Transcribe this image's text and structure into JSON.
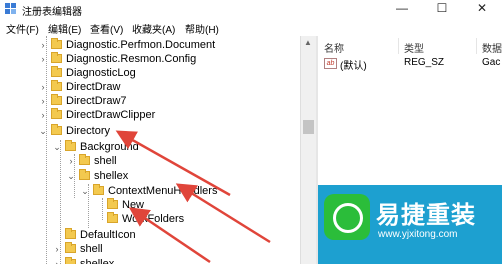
{
  "window": {
    "title": "注册表编辑器",
    "minimize": "—",
    "maximize": "☐",
    "close": "✕"
  },
  "menu": [
    "文件(F)",
    "编辑(E)",
    "查看(V)",
    "收藏夹(A)",
    "帮助(H)"
  ],
  "tree": {
    "items": [
      {
        "label": "Diagnostic.Perfmon.Document",
        "toggle": "›"
      },
      {
        "label": "Diagnostic.Resmon.Config",
        "toggle": "›"
      },
      {
        "label": "DiagnosticLog",
        "toggle": ""
      },
      {
        "label": "DirectDraw",
        "toggle": "›"
      },
      {
        "label": "DirectDraw7",
        "toggle": "›"
      },
      {
        "label": "DirectDrawClipper",
        "toggle": "›"
      },
      {
        "label": "Directory",
        "toggle": "⌄"
      },
      {
        "label": "Background",
        "toggle": "⌄"
      },
      {
        "label": "shell",
        "toggle": "›"
      },
      {
        "label": "shellex",
        "toggle": "⌄"
      },
      {
        "label": "ContextMenuHandlers",
        "toggle": "⌄"
      },
      {
        "label": "New",
        "toggle": ""
      },
      {
        "label": "WorkFolders",
        "toggle": ""
      },
      {
        "label": "DefaultIcon",
        "toggle": ""
      },
      {
        "label": "shell",
        "toggle": "›"
      },
      {
        "label": "shellex",
        "toggle": "›"
      }
    ]
  },
  "values": {
    "headers": {
      "name": "名称",
      "type": "类型",
      "data": "数据"
    },
    "rows": [
      {
        "icon": "ab",
        "name": "(默认)",
        "type": "REG_SZ",
        "data": "Gac"
      }
    ]
  },
  "watermark": {
    "title": "易捷重装",
    "url": "www.yjxitong.com",
    "colors": {
      "background": "#1da0d0",
      "logo": "#2bbd3a"
    }
  },
  "annotation_color": "#e0453a"
}
